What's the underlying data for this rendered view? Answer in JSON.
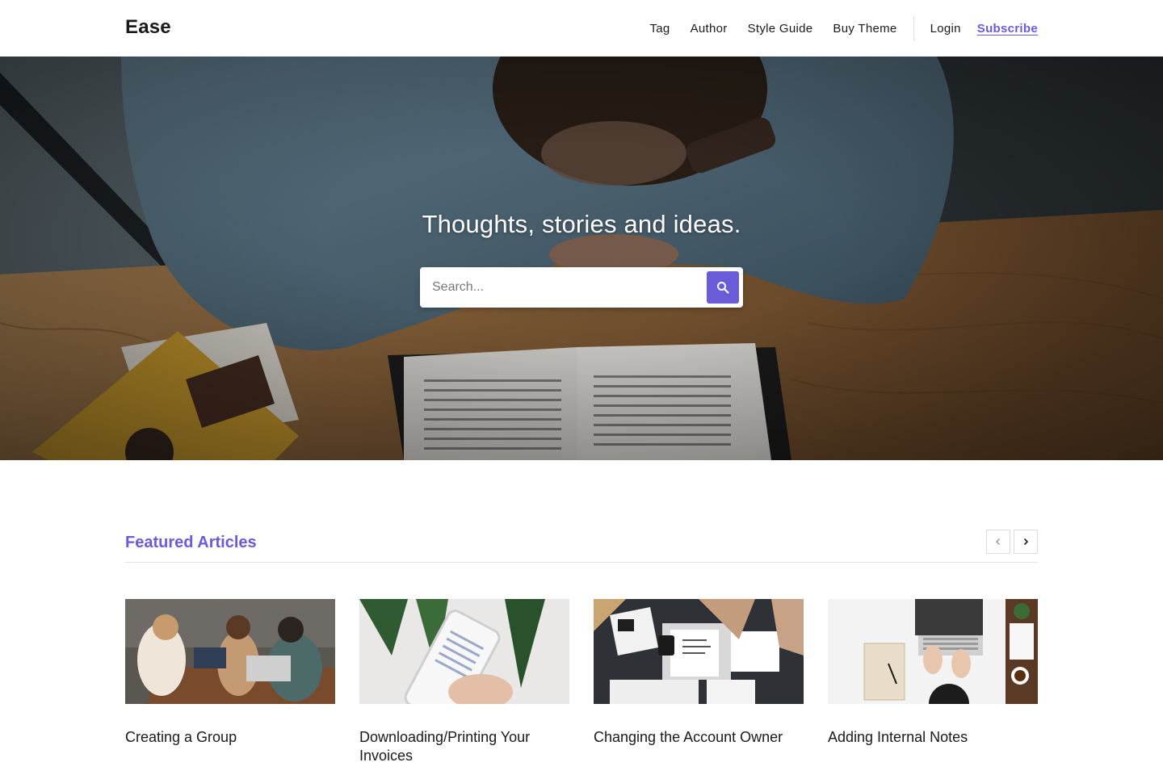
{
  "site": {
    "logo": "Ease"
  },
  "nav": {
    "items": [
      "Tag",
      "Author",
      "Style Guide",
      "Buy Theme"
    ],
    "login": "Login",
    "subscribe": "Subscribe"
  },
  "hero": {
    "title": "Thoughts, stories and ideas.",
    "search_placeholder": "Search...",
    "search_icon": "search-icon"
  },
  "featured": {
    "title": "Featured Articles",
    "prev_icon": "chevron-left-icon",
    "next_icon": "chevron-right-icon",
    "articles": [
      {
        "title": "Creating a Group"
      },
      {
        "title": "Downloading/Printing Your Invoices"
      },
      {
        "title": "Changing the Account Owner"
      },
      {
        "title": "Adding Internal Notes"
      }
    ]
  },
  "colors": {
    "accent": "#6a5bd9",
    "text": "#1a1a1a"
  }
}
